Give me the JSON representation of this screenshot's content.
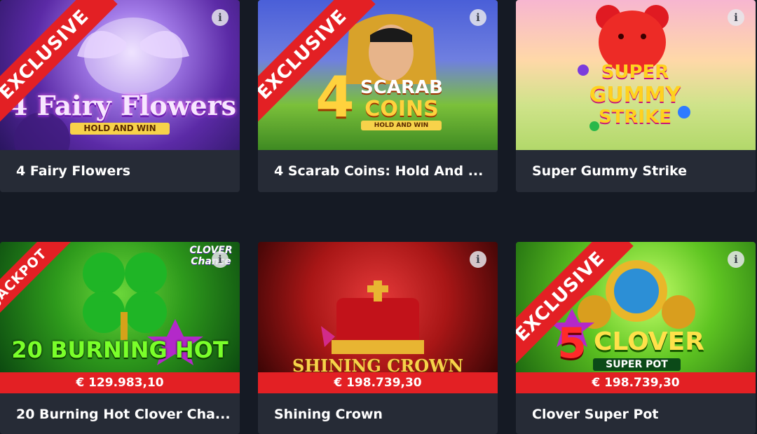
{
  "games": [
    {
      "title": "4 Fairy Flowers",
      "badge": "EXCLUSIVE",
      "art_line1": "4 Fairy Flowers",
      "art_line2": "HOLD AND WIN"
    },
    {
      "title": "4 Scarab Coins: Hold And ...",
      "badge": "EXCLUSIVE",
      "art_line1": "4",
      "art_line2": "SCARAB",
      "art_line3": "COINS",
      "art_line4": "HOLD AND WIN"
    },
    {
      "title": "Super Gummy Strike",
      "badge": "",
      "art_line1": "SUPER",
      "art_line2": "GUMMY",
      "art_line3": "STRIKE"
    },
    {
      "title": "20 Burning Hot Clover Cha...",
      "badge": "JACKPOT",
      "jackpot": "€ 129.983,10",
      "art_line1": "20 BURNING HOT",
      "art_line2": "CLOVER",
      "art_line3": "Chance"
    },
    {
      "title": "Shining Crown",
      "badge": "",
      "jackpot": "€ 198.739,30",
      "art_line1": "SHINING CROWN"
    },
    {
      "title": "Clover Super Pot",
      "badge": "EXCLUSIVE",
      "jackpot": "€ 198.739,30",
      "art_line1": "5",
      "art_line2": "CLOVER",
      "art_line3": "SUPER POT"
    }
  ],
  "info_glyph": "i",
  "colors": {
    "ribbon": "#e32024",
    "card": "#262b36",
    "background": "#151a24"
  }
}
